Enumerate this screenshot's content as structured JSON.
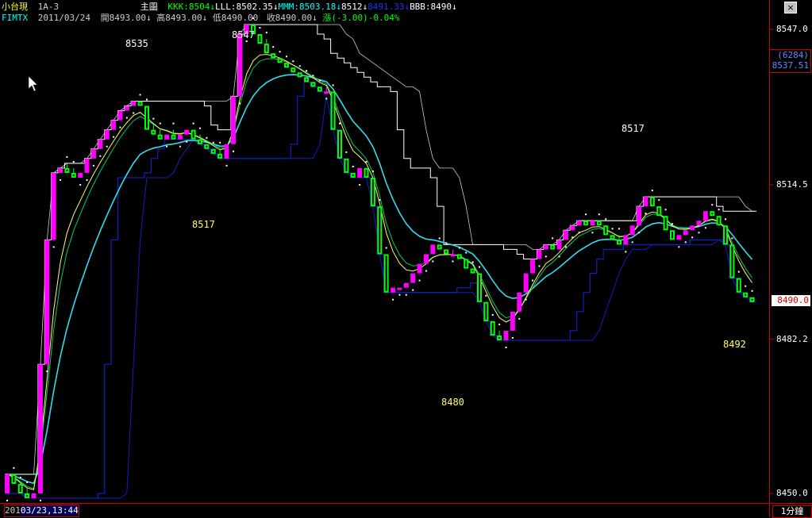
{
  "header": {
    "symbol": "小台現",
    "period": "1A-3",
    "panel": "主圖",
    "indicators": [
      {
        "text": "KKK:8504↓",
        "color": "#00ff00"
      },
      {
        "text": "LLL:8502.35↓",
        "color": "#ffffff"
      },
      {
        "text": "MMM:8503.18↓",
        "color": "#00ffff"
      },
      {
        "text": "8512↓",
        "color": "#ffffff"
      },
      {
        "text": "8491.33↓",
        "color": "#2030ff"
      },
      {
        "text": "BBB:8490↓",
        "color": "#ffffff"
      }
    ],
    "ticker": "FIMTX",
    "date": "2011/03/24",
    "open": "開8493.00↓",
    "high": "高8493.00↓",
    "low": "低8490.00",
    "close": "收8490.00↓",
    "change": "漲(-3.00)-0.04%"
  },
  "axis": {
    "ticks": [
      {
        "label": "8547.0",
        "value": 8547.0
      },
      {
        "label": "8514.5",
        "value": 8514.5
      },
      {
        "label": "8482.2",
        "value": 8482.2
      },
      {
        "label": "8450.0",
        "value": 8450.0
      }
    ],
    "price_box_top": "(6284)",
    "price_box_bottom": "8537.51",
    "current_price": "8490.0",
    "interval": "1分鐘"
  },
  "footer": {
    "date_prefix": "201",
    "date_value": "03/23,13:44"
  },
  "window": {
    "close_glyph": "×"
  },
  "colors": {
    "up": "#ff00ff",
    "down": "#00ff00",
    "ma_fast": "#ffff66",
    "ma_mid": "#00cc66",
    "ma_slow": "#33ddee",
    "envelope_upper": "#ffffff",
    "envelope_lower": "#1020c0",
    "axis_border": "#cc0000"
  },
  "chart_data": {
    "type": "candlestick",
    "y_range": [
      8450,
      8547
    ],
    "annotations": [
      {
        "text": "8535",
        "color": "#ffffff"
      },
      {
        "text": "8547",
        "color": "#ffffff"
      },
      {
        "text": "8517",
        "color": "#ffffff"
      },
      {
        "text": "8517",
        "color": "#ffff66"
      },
      {
        "text": "8480",
        "color": "#ffff66"
      },
      {
        "text": "8492",
        "color": "#ffff66"
      }
    ],
    "candles": [
      [
        8450.0,
        8454.0,
        8450.0,
        8454.0
      ],
      [
        8454.0,
        8454.0,
        8452.0,
        8452.0
      ],
      [
        8452.0,
        8452.0,
        8450.0,
        8450.0
      ],
      [
        8450.0,
        8451.0,
        8449.0,
        8449.0
      ],
      [
        8449.0,
        8450.0,
        8449.0,
        8450.0
      ],
      [
        8450.0,
        8477.0,
        8450.0,
        8477.0
      ],
      [
        8477.0,
        8503.0,
        8477.0,
        8503.0
      ],
      [
        8503.0,
        8517.0,
        8503.0,
        8517.0
      ],
      [
        8517.0,
        8518.0,
        8517.0,
        8518.0
      ],
      [
        8518.0,
        8519.0,
        8517.0,
        8517.0
      ],
      [
        8517.0,
        8518.0,
        8516.0,
        8516.0
      ],
      [
        8516.0,
        8517.0,
        8516.0,
        8517.0
      ],
      [
        8517.0,
        8520.0,
        8517.0,
        8520.0
      ],
      [
        8520.0,
        8522.0,
        8520.0,
        8522.0
      ],
      [
        8522.0,
        8524.0,
        8522.0,
        8524.0
      ],
      [
        8524.0,
        8526.0,
        8524.0,
        8526.0
      ],
      [
        8526.0,
        8528.0,
        8526.0,
        8528.0
      ],
      [
        8528.0,
        8530.0,
        8528.0,
        8530.0
      ],
      [
        8530.0,
        8531.0,
        8530.0,
        8531.0
      ],
      [
        8531.0,
        8532.0,
        8531.0,
        8532.0
      ],
      [
        8532.0,
        8532.0,
        8531.0,
        8531.0
      ],
      [
        8531.0,
        8531.0,
        8526.0,
        8526.0
      ],
      [
        8526.0,
        8527.0,
        8525.0,
        8525.0
      ],
      [
        8525.0,
        8526.0,
        8524.0,
        8524.0
      ],
      [
        8524.0,
        8525.0,
        8524.0,
        8525.0
      ],
      [
        8525.0,
        8526.0,
        8524.0,
        8524.0
      ],
      [
        8524.0,
        8525.0,
        8524.0,
        8525.0
      ],
      [
        8525.0,
        8526.0,
        8525.0,
        8526.0
      ],
      [
        8526.0,
        8526.0,
        8524.0,
        8524.0
      ],
      [
        8524.0,
        8525.0,
        8523.0,
        8523.0
      ],
      [
        8523.0,
        8523.0,
        8522.0,
        8522.0
      ],
      [
        8522.0,
        8522.0,
        8521.0,
        8521.0
      ],
      [
        8521.0,
        8522.0,
        8520.0,
        8520.0
      ],
      [
        8520.0,
        8523.0,
        8520.0,
        8523.0
      ],
      [
        8523.0,
        8533.0,
        8523.0,
        8533.0
      ],
      [
        8533.0,
        8546.0,
        8533.0,
        8546.0
      ],
      [
        8546.0,
        8548.0,
        8546.0,
        8548.0
      ],
      [
        8548.0,
        8548.0,
        8546.0,
        8546.0
      ],
      [
        8546.0,
        8546.0,
        8544.0,
        8544.0
      ],
      [
        8544.0,
        8545.0,
        8542.0,
        8542.0
      ],
      [
        8542.0,
        8542.0,
        8541.0,
        8541.0
      ],
      [
        8541.0,
        8541.0,
        8540.0,
        8540.0
      ],
      [
        8540.0,
        8540.0,
        8539.0,
        8539.0
      ],
      [
        8539.0,
        8539.0,
        8538.0,
        8538.0
      ],
      [
        8538.0,
        8538.0,
        8537.0,
        8537.0
      ],
      [
        8537.0,
        8537.0,
        8536.0,
        8536.0
      ],
      [
        8536.0,
        8536.0,
        8535.0,
        8535.0
      ],
      [
        8535.0,
        8535.0,
        8534.0,
        8534.0
      ],
      [
        8534.0,
        8535.0,
        8534.0,
        8534.0
      ],
      [
        8534.0,
        8534.0,
        8526.0,
        8526.0
      ],
      [
        8526.0,
        8526.0,
        8520.0,
        8520.0
      ],
      [
        8520.0,
        8520.0,
        8517.0,
        8517.0
      ],
      [
        8517.0,
        8517.0,
        8516.0,
        8516.0
      ],
      [
        8516.0,
        8518.0,
        8516.0,
        8518.0
      ],
      [
        8518.0,
        8518.0,
        8516.0,
        8516.0
      ],
      [
        8516.0,
        8516.0,
        8510.0,
        8510.0
      ],
      [
        8510.0,
        8510.0,
        8500.0,
        8500.0
      ],
      [
        8500.0,
        8500.0,
        8492.0,
        8492.0
      ],
      [
        8492.0,
        8493.0,
        8492.0,
        8493.0
      ],
      [
        8493.0,
        8493.0,
        8493.0,
        8493.0
      ],
      [
        8493.0,
        8494.0,
        8493.0,
        8494.0
      ],
      [
        8494.0,
        8496.0,
        8494.0,
        8496.0
      ],
      [
        8496.0,
        8498.0,
        8496.0,
        8498.0
      ],
      [
        8498.0,
        8500.0,
        8498.0,
        8500.0
      ],
      [
        8500.0,
        8502.0,
        8500.0,
        8502.0
      ],
      [
        8502.0,
        8502.0,
        8501.0,
        8501.0
      ],
      [
        8501.0,
        8501.0,
        8500.0,
        8500.0
      ],
      [
        8500.0,
        8501.0,
        8500.0,
        8500.0
      ],
      [
        8500.0,
        8500.0,
        8499.0,
        8499.0
      ],
      [
        8499.0,
        8499.0,
        8497.0,
        8497.0
      ],
      [
        8497.0,
        8497.0,
        8496.0,
        8496.0
      ],
      [
        8496.0,
        8496.0,
        8490.0,
        8490.0
      ],
      [
        8490.0,
        8490.0,
        8486.0,
        8486.0
      ],
      [
        8486.0,
        8486.0,
        8483.0,
        8483.0
      ],
      [
        8483.0,
        8484.0,
        8482.0,
        8482.0
      ],
      [
        8482.0,
        8484.0,
        8482.0,
        8484.0
      ],
      [
        8484.0,
        8488.0,
        8484.0,
        8488.0
      ],
      [
        8488.0,
        8492.0,
        8488.0,
        8492.0
      ],
      [
        8492.0,
        8496.0,
        8492.0,
        8496.0
      ],
      [
        8496.0,
        8499.0,
        8496.0,
        8499.0
      ],
      [
        8499.0,
        8501.0,
        8499.0,
        8501.0
      ],
      [
        8501.0,
        8502.0,
        8501.0,
        8502.0
      ],
      [
        8502.0,
        8502.0,
        8501.0,
        8501.0
      ],
      [
        8501.0,
        8503.0,
        8501.0,
        8503.0
      ],
      [
        8503.0,
        8505.0,
        8503.0,
        8505.0
      ],
      [
        8505.0,
        8506.0,
        8505.0,
        8506.0
      ],
      [
        8506.0,
        8507.0,
        8506.0,
        8507.0
      ],
      [
        8507.0,
        8507.0,
        8506.0,
        8506.0
      ],
      [
        8506.0,
        8507.0,
        8506.0,
        8507.0
      ],
      [
        8507.0,
        8507.0,
        8506.0,
        8506.0
      ],
      [
        8506.0,
        8506.0,
        8504.0,
        8504.0
      ],
      [
        8504.0,
        8504.0,
        8503.0,
        8503.0
      ],
      [
        8503.0,
        8504.0,
        8502.0,
        8502.0
      ],
      [
        8502.0,
        8504.0,
        8502.0,
        8504.0
      ],
      [
        8504.0,
        8506.0,
        8504.0,
        8506.0
      ],
      [
        8506.0,
        8510.0,
        8506.0,
        8510.0
      ],
      [
        8510.0,
        8512.0,
        8510.0,
        8512.0
      ],
      [
        8512.0,
        8512.0,
        8510.0,
        8510.0
      ],
      [
        8510.0,
        8510.0,
        8508.0,
        8508.0
      ],
      [
        8508.0,
        8508.0,
        8505.0,
        8505.0
      ],
      [
        8505.0,
        8505.0,
        8503.0,
        8503.0
      ],
      [
        8503.0,
        8504.0,
        8503.0,
        8504.0
      ],
      [
        8504.0,
        8505.0,
        8504.0,
        8505.0
      ],
      [
        8505.0,
        8506.0,
        8505.0,
        8506.0
      ],
      [
        8506.0,
        8507.0,
        8506.0,
        8507.0
      ],
      [
        8507.0,
        8509.0,
        8507.0,
        8509.0
      ],
      [
        8509.0,
        8509.0,
        8508.0,
        8508.0
      ],
      [
        8508.0,
        8508.0,
        8506.0,
        8506.0
      ],
      [
        8506.0,
        8506.0,
        8502.0,
        8502.0
      ],
      [
        8502.0,
        8502.0,
        8495.0,
        8495.0
      ],
      [
        8495.0,
        8495.0,
        8492.0,
        8492.0
      ],
      [
        8492.0,
        8492.0,
        8491.0,
        8491.0
      ],
      [
        8491.0,
        8491.0,
        8490.0,
        8490.0
      ]
    ]
  }
}
